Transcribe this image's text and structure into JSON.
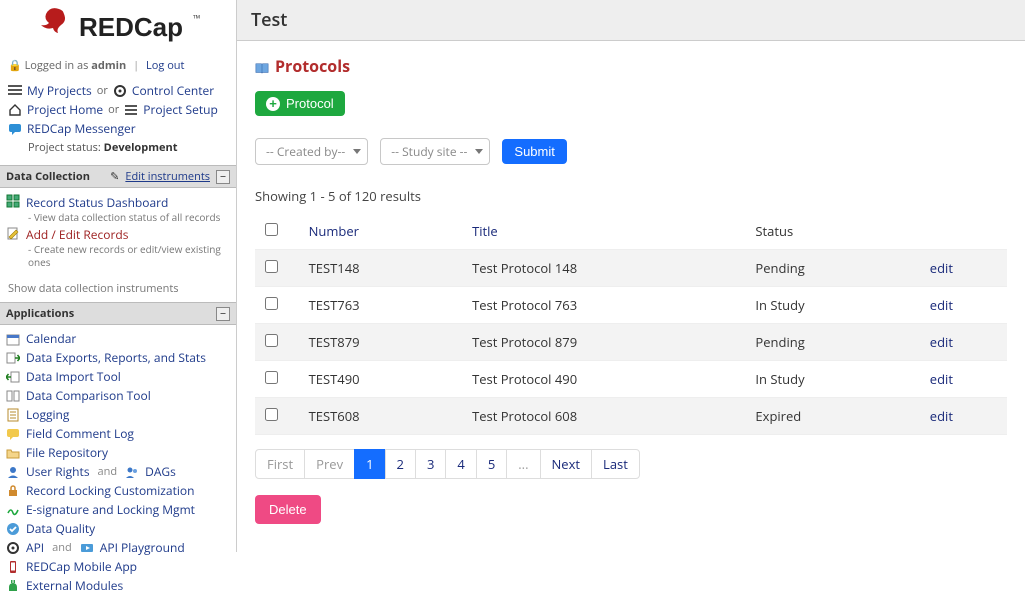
{
  "sidebar": {
    "login": {
      "prefix": "Logged in as",
      "user": "admin",
      "logout": "Log out"
    },
    "nav": {
      "my_projects": "My Projects",
      "or": "or",
      "control_center": "Control Center",
      "project_home": "Project Home",
      "project_setup": "Project Setup",
      "messenger": "REDCap Messenger",
      "project_status_label": "Project status:",
      "project_status_value": "Development"
    },
    "data_collection": {
      "heading": "Data Collection",
      "edit_instruments": "Edit instruments",
      "items": [
        {
          "title": "Record Status Dashboard",
          "desc": "- View data collection status of all records",
          "red": false,
          "icon": "grid"
        },
        {
          "title": "Add / Edit Records",
          "desc": "- Create new records or edit/view existing ones",
          "red": true,
          "icon": "pencil-page"
        }
      ],
      "show_all": "Show data collection instruments"
    },
    "apps": {
      "heading": "Applications",
      "items": [
        {
          "label": "Calendar",
          "icon": "calendar"
        },
        {
          "label": "Data Exports, Reports, and Stats",
          "icon": "export"
        },
        {
          "label": "Data Import Tool",
          "icon": "import"
        },
        {
          "label": "Data Comparison Tool",
          "icon": "compare"
        },
        {
          "label": "Logging",
          "icon": "log"
        },
        {
          "label": "Field Comment Log",
          "icon": "comment"
        },
        {
          "label": "File Repository",
          "icon": "folder"
        },
        {
          "label": "User Rights",
          "and": "and",
          "label2": "DAGs",
          "icon": "user",
          "icon2": "users"
        },
        {
          "label": "Record Locking Customization",
          "icon": "lock-gear"
        },
        {
          "label": "E-signature and Locking Mgmt",
          "icon": "sig"
        },
        {
          "label": "Data Quality",
          "icon": "check"
        },
        {
          "label": "API",
          "and": "and",
          "label2": "API Playground",
          "icon": "api",
          "icon2": "api-play"
        },
        {
          "label": "REDCap Mobile App",
          "icon": "mobile"
        },
        {
          "label": "External Modules",
          "icon": "plugin"
        }
      ]
    }
  },
  "main": {
    "page_title": "Test",
    "protocols_heading": "Protocols",
    "add_button": "Protocol",
    "filters": {
      "created_by": "-- Created by--",
      "study_site": "-- Study site --",
      "submit": "Submit"
    },
    "summary": "Showing 1 - 5 of 120 results",
    "table": {
      "headers": {
        "number": "Number",
        "title": "Title",
        "status": "Status"
      },
      "rows": [
        {
          "number": "TEST148",
          "title": "Test Protocol 148",
          "status": "Pending",
          "action": "edit"
        },
        {
          "number": "TEST763",
          "title": "Test Protocol 763",
          "status": "In Study",
          "action": "edit"
        },
        {
          "number": "TEST879",
          "title": "Test Protocol 879",
          "status": "Pending",
          "action": "edit"
        },
        {
          "number": "TEST490",
          "title": "Test Protocol 490",
          "status": "In Study",
          "action": "edit"
        },
        {
          "number": "TEST608",
          "title": "Test Protocol 608",
          "status": "Expired",
          "action": "edit"
        }
      ]
    },
    "pager": {
      "first": "First",
      "prev": "Prev",
      "pages": [
        "1",
        "2",
        "3",
        "4",
        "5"
      ],
      "ellipsis": "...",
      "next": "Next",
      "last": "Last",
      "active": "1"
    },
    "delete": "Delete"
  }
}
